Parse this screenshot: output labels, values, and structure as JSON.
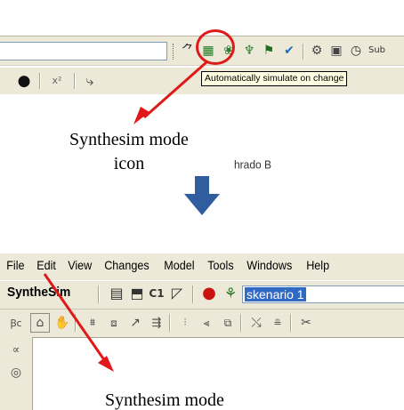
{
  "top_screenshot": {
    "tooltip_text": "Automatically simulate on change",
    "toolbar_icons": [
      {
        "name": "walk-icon",
        "glyph": "⺈",
        "color": "#2a2a2a"
      },
      {
        "name": "auto-simulate-icon",
        "glyph": "▦",
        "color": "#1f7a1f"
      },
      {
        "name": "figure-icon",
        "glyph": "❀",
        "color": "#2e7d32"
      },
      {
        "name": "person-icon",
        "glyph": "♆",
        "color": "#2e7d32"
      },
      {
        "name": "run-icon",
        "glyph": "⚑",
        "color": "#1f6f1f"
      },
      {
        "name": "runner-icon",
        "glyph": "✔",
        "color": "#1f6fb5"
      },
      {
        "name": "network-icon",
        "glyph": "⚙",
        "color": "#444444"
      },
      {
        "name": "chart-icon",
        "glyph": "▣",
        "color": "#444444"
      },
      {
        "name": "clock-icon",
        "glyph": "◷",
        "color": "#333333"
      },
      {
        "name": "sub-icon",
        "glyph": "Sub",
        "color": "#333333"
      }
    ],
    "toolbar2_icons": [
      {
        "name": "pie-icon",
        "glyph": "●",
        "color": "#111111"
      },
      {
        "name": "formula-icon",
        "glyph": "x²",
        "color": "#666666"
      },
      {
        "name": "arrow-path-icon",
        "glyph": "⤷",
        "color": "#444444"
      }
    ],
    "partial_text": "hrado B"
  },
  "caption1": {
    "line1": "Synthesim mode",
    "line2": "icon"
  },
  "bottom_screenshot": {
    "menu": [
      "File",
      "Edit",
      "View",
      "Changes",
      "Model",
      "Tools",
      "Windows",
      "Help"
    ],
    "synthesim_label": "SyntheSim",
    "scenario_value": "skenario 1",
    "toolbar_icons": [
      {
        "name": "save-icon",
        "glyph": "▤",
        "color": "#333333"
      },
      {
        "name": "open-icon",
        "glyph": "⬒",
        "color": "#333333"
      },
      {
        "name": "compare-icon",
        "glyph": "C1",
        "color": "#333333"
      },
      {
        "name": "graph-icon",
        "glyph": "◸",
        "color": "#333333"
      },
      {
        "name": "stop-icon",
        "glyph": "●",
        "color": "#cc1111"
      },
      {
        "name": "simulate-icon",
        "glyph": "⚘",
        "color": "#1f7a1f"
      }
    ],
    "tool_row_icons": [
      "text-tool-icon",
      "lock-icon",
      "hand-icon",
      "variable-icon",
      "box-icon",
      "arrow-icon",
      "rate-icon",
      "level-icon",
      "shadow-icon",
      "flow-icon",
      "delete-icon",
      "comment-icon",
      "cut-icon"
    ],
    "side_icons": [
      "cloud-icon",
      "source-icon"
    ]
  },
  "caption2": {
    "line1": "Synthesim mode"
  },
  "colors": {
    "highlight": "#e01a1a",
    "arrow_blue": "#2f5d9e",
    "toolbar_bg": "#ece9d8",
    "selection": "#316ac5"
  }
}
